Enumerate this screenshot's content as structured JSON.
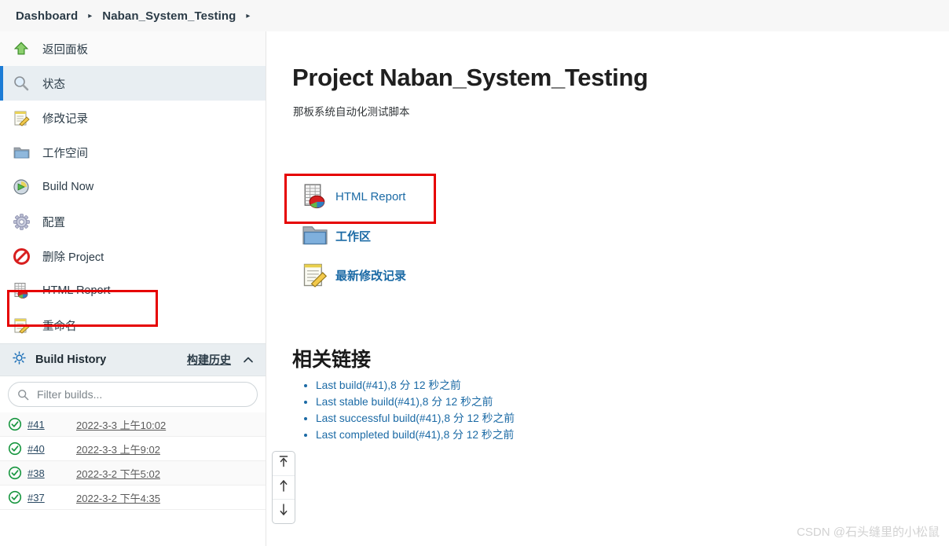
{
  "header": {
    "breadcrumbs": [
      {
        "label": "Dashboard"
      },
      {
        "label": "Naban_System_Testing"
      }
    ],
    "separator": "▸"
  },
  "sidebar": {
    "items": [
      {
        "label": "返回面板",
        "icon": "green-up-arrow-icon",
        "name": "sidebar-item-back-to-dashboard",
        "active": false
      },
      {
        "label": "状态",
        "icon": "magnifier-icon",
        "name": "sidebar-item-status",
        "active": true
      },
      {
        "label": "修改记录",
        "icon": "notepad-pencil-icon",
        "name": "sidebar-item-changes",
        "active": false
      },
      {
        "label": "工作空间",
        "icon": "folder-icon",
        "name": "sidebar-item-workspace",
        "active": false
      },
      {
        "label": "Build Now",
        "icon": "build-clock-icon",
        "name": "sidebar-item-build-now",
        "active": false
      },
      {
        "label": "配置",
        "icon": "gear-icon",
        "name": "sidebar-item-configure",
        "active": false
      },
      {
        "label": "删除 Project",
        "icon": "delete-forbidden-icon",
        "name": "sidebar-item-delete-project",
        "active": false
      },
      {
        "label": "HTML Report",
        "icon": "html-report-icon",
        "name": "sidebar-item-html-report",
        "active": false
      },
      {
        "label": "重命名",
        "icon": "notepad-pencil-icon",
        "name": "sidebar-item-rename",
        "active": false
      }
    ],
    "build_history": {
      "title": "Build History",
      "link_label": "构建历史",
      "filter_placeholder": "Filter builds...",
      "filter_value": "",
      "rows": [
        {
          "number": "#41",
          "date": "2022-3-3 上午10:02",
          "status": "success"
        },
        {
          "number": "#40",
          "date": "2022-3-3 上午9:02",
          "status": "success"
        },
        {
          "number": "#38",
          "date": "2022-3-2 下午5:02",
          "status": "success"
        },
        {
          "number": "#37",
          "date": "2022-3-2 下午4:35",
          "status": "success"
        }
      ]
    }
  },
  "main": {
    "title": "Project Naban_System_Testing",
    "description": "那板系统自动化测试脚本",
    "actions": [
      {
        "label": "HTML Report",
        "icon": "html-report-icon",
        "name": "action-html-report"
      },
      {
        "label": "工作区",
        "icon": "folder-icon",
        "name": "action-workspace"
      },
      {
        "label": "最新修改记录",
        "icon": "notepad-pencil-icon",
        "name": "action-recent-changes"
      }
    ],
    "links_heading": "相关链接",
    "links": [
      {
        "label": "Last build(#41),8 分 12 秒之前"
      },
      {
        "label": "Last stable build(#41),8 分 12 秒之前"
      },
      {
        "label": "Last successful build(#41),8 分 12 秒之前"
      },
      {
        "label": "Last completed build(#41),8 分 12 秒之前"
      }
    ]
  },
  "scroll_nav": [
    {
      "name": "scroll-to-top-button",
      "icon": "arrow-up-to-bar-icon"
    },
    {
      "name": "scroll-up-button",
      "icon": "arrow-up-icon"
    },
    {
      "name": "scroll-down-button",
      "icon": "arrow-down-icon"
    }
  ],
  "watermark": "CSDN @石头缝里的小松鼠",
  "colors": {
    "accent": "#1b6aa5",
    "active_bar": "#1c7cd6",
    "annotation": "#e60000",
    "header_bg": "#f7f7f7",
    "build_history_bg": "#e9eef1",
    "success": "#1a9e4b"
  }
}
